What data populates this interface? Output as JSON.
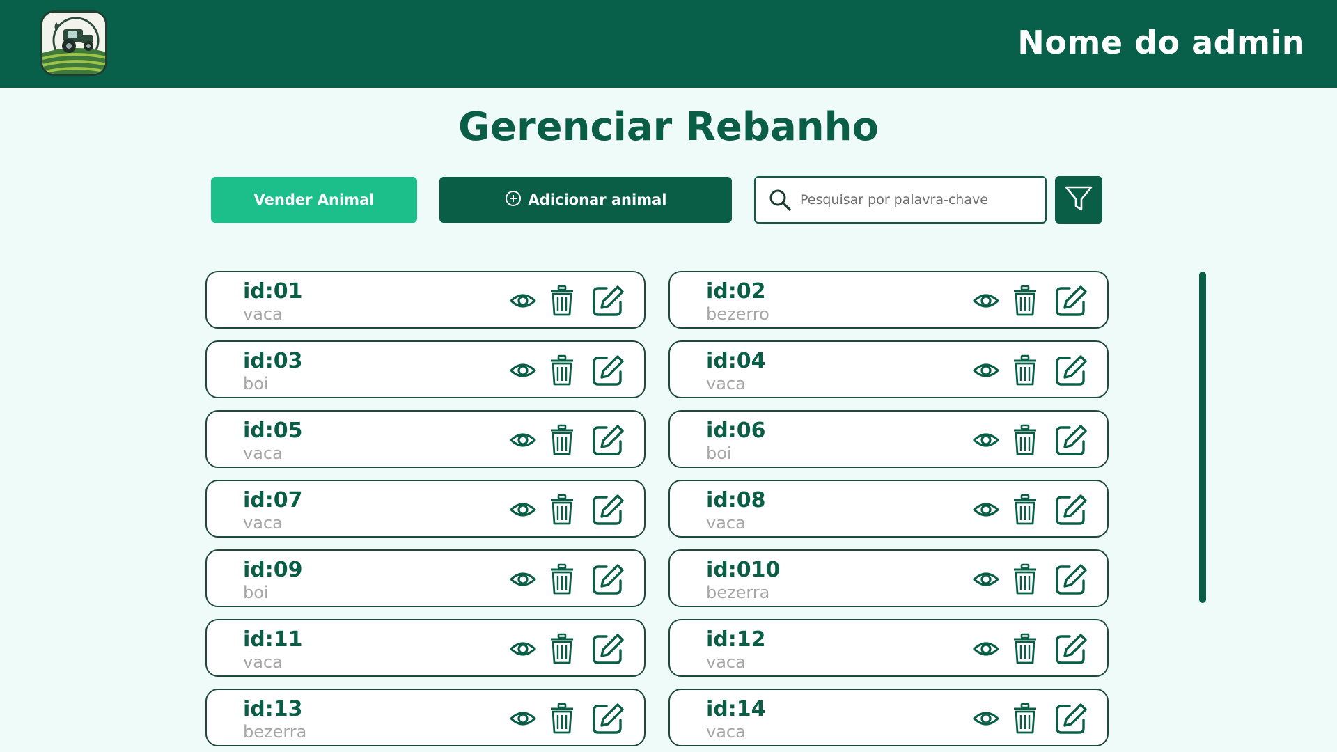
{
  "header": {
    "admin_name": "Nome do admin",
    "logo_icon": "farm-tractor-logo-icon"
  },
  "page": {
    "title": "Gerenciar Rebanho"
  },
  "toolbar": {
    "sell_label": "Vender Animal",
    "add_label": "Adicionar animal",
    "search_placeholder": "Pesquisar por palavra-chave",
    "search_value": "",
    "filter_icon": "filter-icon"
  },
  "animals": [
    {
      "id": "id:01",
      "kind": "vaca"
    },
    {
      "id": "id:02",
      "kind": "bezerro"
    },
    {
      "id": "id:03",
      "kind": "boi"
    },
    {
      "id": "id:04",
      "kind": "vaca"
    },
    {
      "id": "id:05",
      "kind": "vaca"
    },
    {
      "id": "id:06",
      "kind": "boi"
    },
    {
      "id": "id:07",
      "kind": "vaca"
    },
    {
      "id": "id:08",
      "kind": "vaca"
    },
    {
      "id": "id:09",
      "kind": "boi"
    },
    {
      "id": "id:010",
      "kind": "bezerra"
    },
    {
      "id": "id:11",
      "kind": "vaca"
    },
    {
      "id": "id:12",
      "kind": "vaca"
    },
    {
      "id": "id:13",
      "kind": "bezerra"
    },
    {
      "id": "id:14",
      "kind": "vaca"
    }
  ],
  "row_actions": [
    "eye-icon",
    "trash-icon",
    "edit-icon"
  ],
  "colors": {
    "primary": "#0b5e46",
    "header": "#08604a",
    "accent": "#1cbf8a",
    "background": "#effbf8",
    "muted_text": "#a6a6a6"
  }
}
